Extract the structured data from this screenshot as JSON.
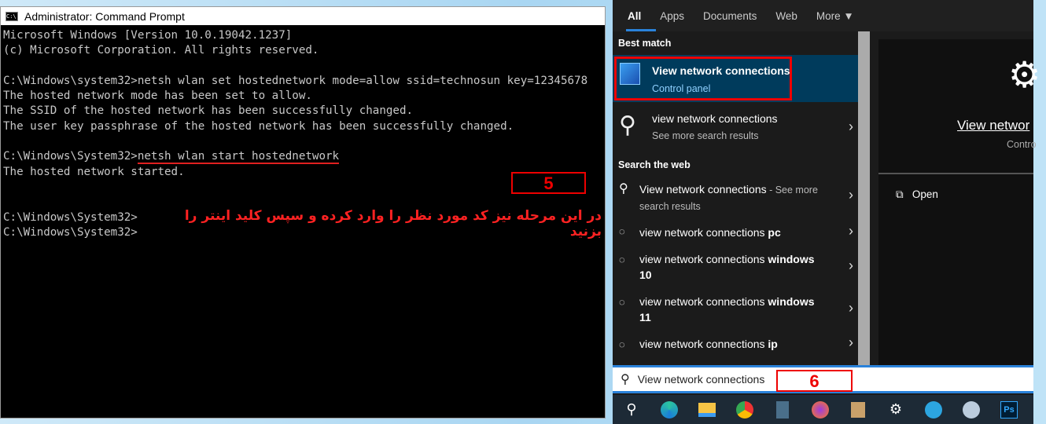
{
  "cmd": {
    "title": "Administrator: Command Prompt",
    "lines": [
      "Microsoft Windows [Version 10.0.19042.1237]",
      "(c) Microsoft Corporation. All rights reserved.",
      "",
      "C:\\Windows\\system32>",
      "The hosted network mode has been set to allow.",
      "The SSID of the hosted network has been successfully changed.",
      "The user key passphrase of the hosted network has been successfully changed.",
      "",
      "C:\\Windows\\System32>",
      "The hosted network started.",
      "",
      "",
      "C:\\Windows\\System32>",
      "C:\\Windows\\System32>"
    ],
    "cmd1": "netsh wlan set hostednetwork mode=allow ssid=technosun key=12345678",
    "cmd2": "netsh wlan start hostednetwork"
  },
  "annotations": {
    "step5": "5",
    "step6": "6",
    "note": "در این مرحله نیز کد مورد نظر را وارد کرده و سپس کلید اینتر را بزنید"
  },
  "search": {
    "tabs": [
      "All",
      "Apps",
      "Documents",
      "Web",
      "More ▼"
    ],
    "best_match_label": "Best match",
    "best": {
      "title": "View network connections",
      "sub": "Control panel"
    },
    "more": {
      "title": "view network connections",
      "sub": "See more search results"
    },
    "web_label": "Search the web",
    "web_first": {
      "title": "View network connections",
      "suffix": " - See more",
      "sub": "search results"
    },
    "suggestions": [
      {
        "pre": "view network connections ",
        "bold": "pc"
      },
      {
        "pre": "view network connections ",
        "bold": "windows",
        "line2": "10"
      },
      {
        "pre": "view network connections ",
        "bold": "windows",
        "line2": "11"
      },
      {
        "pre": "view network connections ",
        "bold": "ip"
      }
    ],
    "preview": {
      "title": "View networ",
      "sub": "Contro",
      "open": "Open"
    },
    "query": "View network connections"
  },
  "colors": {
    "accent": "#2a82da",
    "highlight": "#003b5c",
    "annot": "#e00000"
  }
}
